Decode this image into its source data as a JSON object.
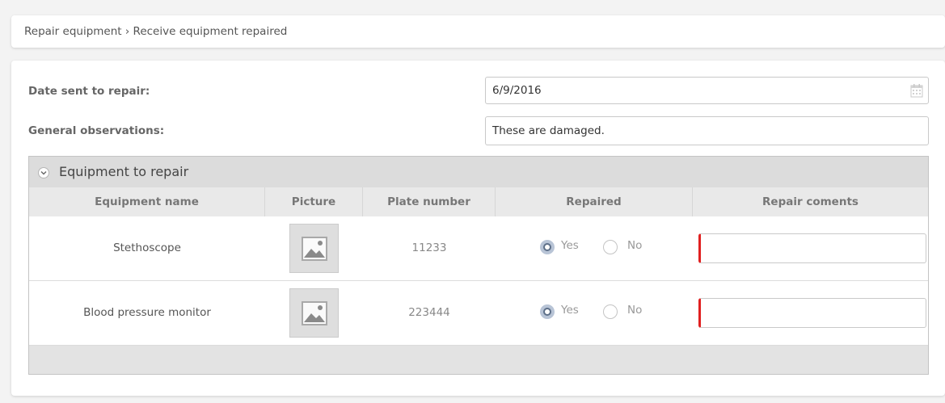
{
  "breadcrumb": "Repair equipment › Receive equipment repaired",
  "form": {
    "date_label": "Date sent to repair:",
    "date_value": "6/9/2016",
    "observations_label": "General observations:",
    "observations_value": "These are damaged."
  },
  "grid": {
    "title": "Equipment to repair",
    "columns": [
      "Equipment name",
      "Picture",
      "Plate number",
      "Repaired",
      "Repair coments"
    ],
    "rows": [
      {
        "name": "Stethoscope",
        "plate": "11233",
        "repaired": "Yes",
        "yes_label": "Yes",
        "no_label": "No",
        "comment": ""
      },
      {
        "name": "Blood pressure monitor",
        "plate": "223444",
        "repaired": "Yes",
        "yes_label": "Yes",
        "no_label": "No",
        "comment": ""
      }
    ]
  },
  "colors": {
    "required_marker": "#e02020",
    "radio_selected": "#5d6f88"
  },
  "icons": {
    "date_picker": "calendar-icon",
    "picture": "image-placeholder-icon",
    "grid_toggle": "chevron-down-icon"
  }
}
